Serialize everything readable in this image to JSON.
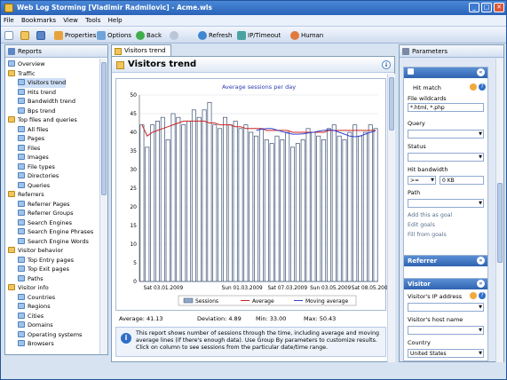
{
  "window": {
    "title": "Web Log Storming  [Vladimir Radmilovic] - Acme.wls",
    "buttons": [
      "_",
      "□",
      "✕"
    ]
  },
  "menu": [
    "File",
    "Bookmarks",
    "View",
    "Tools",
    "Help"
  ],
  "toolbar": {
    "properties": "Properties",
    "options": "Options",
    "back": "Back",
    "refresh": "Refresh",
    "ip_timeout": "IP/Timeout",
    "human": "Human"
  },
  "reports_panel": {
    "title": "Reports",
    "items": [
      {
        "label": "Overview",
        "level": 0,
        "kind": "leaf"
      },
      {
        "label": "Traffic",
        "level": 0,
        "kind": "folder"
      },
      {
        "label": "Visitors trend",
        "level": 1,
        "kind": "leaf",
        "selected": true
      },
      {
        "label": "Hits trend",
        "level": 1,
        "kind": "leaf"
      },
      {
        "label": "Bandwidth trend",
        "level": 1,
        "kind": "leaf"
      },
      {
        "label": "Bps trend",
        "level": 1,
        "kind": "leaf"
      },
      {
        "label": "Top files and queries",
        "level": 0,
        "kind": "folder"
      },
      {
        "label": "All files",
        "level": 1,
        "kind": "leaf"
      },
      {
        "label": "Pages",
        "level": 1,
        "kind": "leaf"
      },
      {
        "label": "Files",
        "level": 1,
        "kind": "leaf"
      },
      {
        "label": "Images",
        "level": 1,
        "kind": "leaf"
      },
      {
        "label": "File types",
        "level": 1,
        "kind": "leaf"
      },
      {
        "label": "Directories",
        "level": 1,
        "kind": "leaf"
      },
      {
        "label": "Queries",
        "level": 1,
        "kind": "leaf"
      },
      {
        "label": "Referrers",
        "level": 0,
        "kind": "folder"
      },
      {
        "label": "Referrer Pages",
        "level": 1,
        "kind": "leaf"
      },
      {
        "label": "Referrer Groups",
        "level": 1,
        "kind": "leaf"
      },
      {
        "label": "Search Engines",
        "level": 1,
        "kind": "leaf"
      },
      {
        "label": "Search Engine Phrases",
        "level": 1,
        "kind": "leaf"
      },
      {
        "label": "Search Engine Words",
        "level": 1,
        "kind": "leaf"
      },
      {
        "label": "Visitor behavior",
        "level": 0,
        "kind": "folder"
      },
      {
        "label": "Top Entry pages",
        "level": 1,
        "kind": "leaf"
      },
      {
        "label": "Top Exit pages",
        "level": 1,
        "kind": "leaf"
      },
      {
        "label": "Paths",
        "level": 1,
        "kind": "leaf"
      },
      {
        "label": "Visitor info",
        "level": 0,
        "kind": "folder"
      },
      {
        "label": "Countries",
        "level": 1,
        "kind": "leaf"
      },
      {
        "label": "Regions",
        "level": 1,
        "kind": "leaf"
      },
      {
        "label": "Cities",
        "level": 1,
        "kind": "leaf"
      },
      {
        "label": "Domains",
        "level": 1,
        "kind": "leaf"
      },
      {
        "label": "Operating systems",
        "level": 1,
        "kind": "leaf"
      },
      {
        "label": "Browsers",
        "level": 1,
        "kind": "leaf"
      }
    ]
  },
  "content": {
    "tab": "Visitors trend",
    "title": "Visitors trend",
    "stats": {
      "average": "Average: 41.13",
      "deviation": "Deviation: 4.89",
      "min": "Min: 33.00",
      "max": "Max: 50.43"
    },
    "info": "This report shows number of sessions through the time, including average and moving average lines (if there's enough data). Use Group By parameters to customize results. Click on column to see sessions from the particular date/time range."
  },
  "chart_data": {
    "type": "bar",
    "title": "Average sessions per day",
    "ylim": [
      0,
      50
    ],
    "yticks": [
      0,
      5,
      10,
      15,
      20,
      25,
      30,
      35,
      40,
      45,
      50
    ],
    "xtick_labels": [
      "Sat 03.01.2009",
      "Sun 01.03.2009",
      "Sat 07.03.2009",
      "Sun 03.05.2009",
      "Sat 08.05.2009"
    ],
    "series": [
      {
        "name": "Sessions",
        "color": "#8fa8c8",
        "values": [
          42,
          36,
          42,
          43,
          44,
          38,
          45,
          44,
          42,
          43,
          46,
          44,
          46,
          48,
          42,
          41,
          44,
          42,
          43,
          41,
          42,
          40,
          39,
          41,
          38,
          37,
          39,
          38,
          40,
          36,
          37,
          38,
          41,
          40,
          39,
          38,
          41,
          42,
          39,
          38,
          40,
          42,
          39,
          40,
          42,
          41
        ]
      },
      {
        "name": "Average",
        "color": "#cc2222"
      },
      {
        "name": "Moving average",
        "color": "#3344cc"
      }
    ],
    "average_line": [
      42,
      39,
      40,
      40.5,
      41,
      41.5,
      42,
      42.5,
      43,
      43,
      43,
      43,
      43,
      42.5,
      42.5,
      42,
      42,
      42,
      41.5,
      41.5,
      41,
      41,
      41,
      41,
      40.5,
      40.5,
      40.5,
      40.5,
      40.5,
      40,
      40,
      40,
      40,
      40,
      40,
      40,
      40.5,
      40.5,
      40.5,
      40.5,
      40.5,
      40.5,
      40.5,
      40.5,
      40.5,
      40.5
    ],
    "moving_average": [
      null,
      null,
      null,
      null,
      null,
      null,
      null,
      null,
      null,
      null,
      null,
      null,
      null,
      null,
      null,
      null,
      null,
      null,
      null,
      null,
      null,
      null,
      40.5,
      40.8,
      41,
      41,
      40.6,
      40.2,
      39.8,
      39.5,
      39.5,
      39.6,
      39.8,
      40,
      40.3,
      40.5,
      40.7,
      40.5,
      40,
      39.5,
      39,
      38.8,
      39,
      39.5,
      40,
      40.4
    ],
    "legend": [
      "Sessions",
      "Average",
      "Moving average"
    ],
    "legend_position": "bottom",
    "grid": true
  },
  "parameters_panel": {
    "title": "Parameters",
    "filter": {
      "hit_match": "Hit match",
      "file_wildcards_label": "File wildcards",
      "file_wildcards_value": "*.html, *.php",
      "query_label": "Query",
      "status_label": "Status",
      "hit_bandwidth_label": "Hit bandwidth",
      "bandwidth_op": ">=",
      "bandwidth_value": "0 KB",
      "path_label": "Path",
      "links": [
        "Add this as goal",
        "Edit goals",
        "Fill from goals"
      ]
    },
    "referrer_title": "Referrer",
    "visitor_title": "Visitor",
    "visitor": {
      "ip_label": "Visitor's IP address",
      "host_label": "Visitor's host name",
      "country_label": "Country",
      "country_value": "United States"
    }
  }
}
